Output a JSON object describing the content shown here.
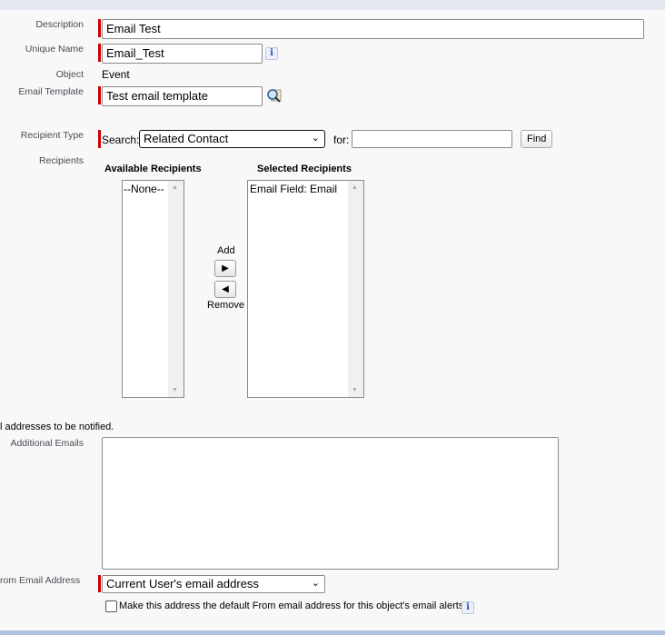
{
  "labels": {
    "description": "Description",
    "unique_name": "Unique Name",
    "object": "Object",
    "email_template": "Email Template",
    "recipient_type": "Recipient Type",
    "recipients": "Recipients",
    "additional_emails": "Additional Emails",
    "from_email": "rom Email Address"
  },
  "fields": {
    "description": "Email Test",
    "unique_name": "Email_Test",
    "object": "Event",
    "email_template": "Test email template",
    "search_label": "Search:",
    "search_type": "Related Contact",
    "for_label": "for:",
    "for_value": "",
    "find_button": "Find",
    "additional_emails": "",
    "from_email": "Current User's email address"
  },
  "recipients": {
    "available_header": "Available Recipients",
    "selected_header": "Selected Recipients",
    "available": [
      "--None--"
    ],
    "selected": [
      "Email Field: Email"
    ],
    "add_label": "Add",
    "remove_label": "Remove"
  },
  "note": "l addresses to be notified.",
  "default_checkbox": {
    "label": "Make this address the default From email address for this object's email alerts.",
    "checked": false
  },
  "info_icon": "i"
}
